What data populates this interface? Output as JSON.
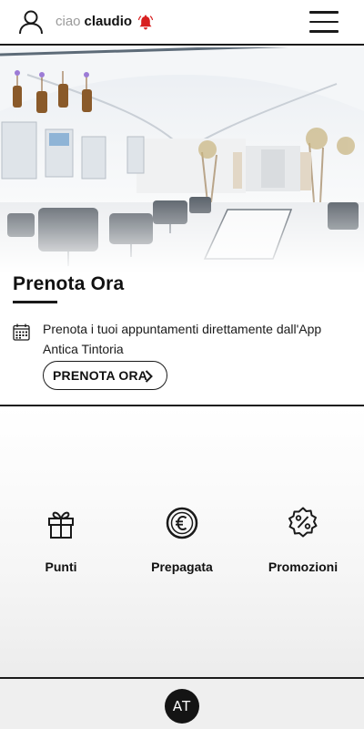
{
  "header": {
    "greeting": "ciao",
    "username": "claudio",
    "icons": {
      "user": "user-icon",
      "bell": "bell-icon",
      "menu": "hamburger-menu-icon"
    },
    "bell_color": "#d81f1f"
  },
  "hero": {
    "image": "salon-interior-photo"
  },
  "booking": {
    "title": "Prenota Ora",
    "description": "Prenota i tuoi appuntamenti direttamente dall'App Antica Tintoria",
    "button_label": "PRENOTA ORA",
    "icon": "calendar-icon"
  },
  "services": [
    {
      "label": "Punti",
      "icon": "gift-icon"
    },
    {
      "label": "Prepagata",
      "icon": "euro-icon"
    },
    {
      "label": "Promozioni",
      "icon": "percent-badge-icon"
    }
  ],
  "bottom_bar": {
    "logo_text": "AT",
    "logo_color": "#141414"
  }
}
